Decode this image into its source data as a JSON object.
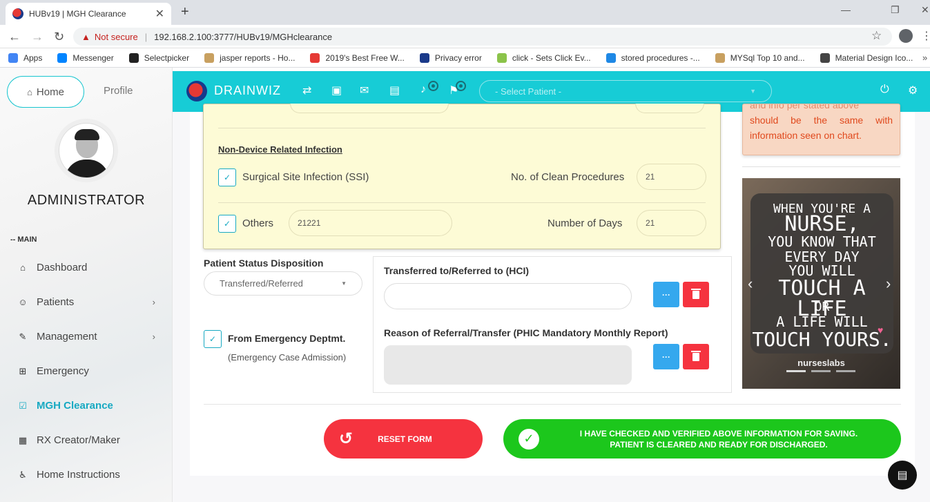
{
  "browser": {
    "tab_title": "HUBv19 | MGH Clearance",
    "not_secure": "Not secure",
    "url": "192.168.2.100:3777/HUBv19/MGHclearance",
    "bookmarks": [
      {
        "label": "Apps",
        "color": "#4285f4"
      },
      {
        "label": "Messenger",
        "color": "#0084ff"
      },
      {
        "label": "Selectpicker",
        "color": "#222"
      },
      {
        "label": "jasper reports - Ho...",
        "color": "#c8a060"
      },
      {
        "label": "2019's Best Free W...",
        "color": "#e53935"
      },
      {
        "label": "Privacy error",
        "color": "#1a3a8a"
      },
      {
        "label": "click - Sets Click Ev...",
        "color": "#8bc34a"
      },
      {
        "label": "stored procedures -...",
        "color": "#1e88e5"
      },
      {
        "label": "MYSql Top 10 and...",
        "color": "#c8a060"
      },
      {
        "label": "Material Design Ico...",
        "color": "#444"
      }
    ]
  },
  "sidebar": {
    "home": "Home",
    "profile": "Profile",
    "user_name": "ADMINISTRATOR",
    "section": "-- MAIN",
    "items": [
      {
        "label": "Dashboard",
        "icon": "home-icon",
        "glyph": "⌂"
      },
      {
        "label": "Patients",
        "icon": "smile-icon",
        "glyph": "☺",
        "chevron": true
      },
      {
        "label": "Management",
        "icon": "wrench-icon",
        "glyph": "✎",
        "chevron": true
      },
      {
        "label": "Emergency",
        "icon": "plus-square-icon",
        "glyph": "⊞"
      },
      {
        "label": "MGH Clearance",
        "icon": "checkbox-icon",
        "glyph": "☑",
        "active": true
      },
      {
        "label": "RX Creator/Maker",
        "icon": "apps-icon",
        "glyph": "▦"
      },
      {
        "label": "Home Instructions",
        "icon": "wheelchair-icon",
        "glyph": "♿"
      }
    ]
  },
  "topbar": {
    "brand": "DRAINWIZ",
    "patient_placeholder": "- Select Patient -"
  },
  "infection": {
    "section_title": "Non-Device Related Infection",
    "ssi_label": "Surgical Site Infection (SSI)",
    "clean_proc_label": "No. of Clean Procedures",
    "clean_proc_value": "21",
    "others_label": "Others",
    "others_value": "21221",
    "days_label": "Number of Days",
    "days_value": "21"
  },
  "disposition": {
    "label": "Patient Status Disposition",
    "selected": "Transferred/Referred",
    "emergency_label": "From Emergency Deptmt.",
    "emergency_sub": "(Emergency Case Admission)",
    "hci_label": "Transferred to/Referred to (HCI)",
    "reason_label": "Reason of Referral/Transfer (PHIC Mandatory Monthly Report)",
    "dots": "···"
  },
  "actions": {
    "reset": "RESET FORM",
    "verify_line1": "I HAVE CHECKED AND VERIFIED ABOVE INFORMATION FOR SAVING.",
    "verify_line2": "PATIENT IS CLEARED AND READY FOR DISCHARGED."
  },
  "note": {
    "cut_line": "and  info  per  stated  above",
    "text": "should be the same with information seen on chart."
  },
  "poster": {
    "lines": [
      "WHEN YOU'RE A",
      "NURSE,",
      "YOU KNOW THAT",
      "EVERY DAY",
      "YOU WILL",
      "TOUCH A LIFE",
      "OR",
      "A LIFE WILL",
      "TOUCH YOURS."
    ],
    "brand": "nurseslabs"
  },
  "colors": {
    "accent": "#17ccd6",
    "danger": "#f5333f",
    "success": "#1cc71c",
    "info": "#35a8ee"
  }
}
